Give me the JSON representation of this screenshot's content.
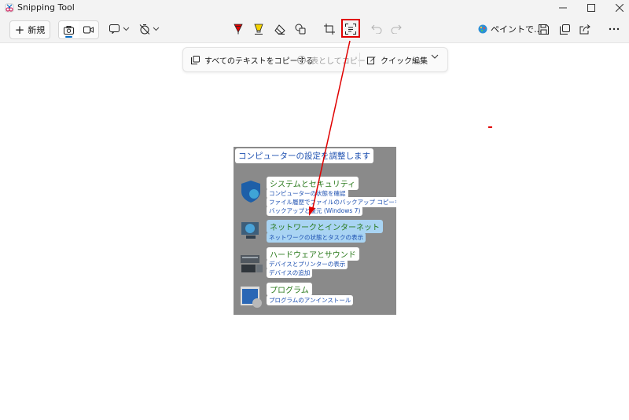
{
  "window": {
    "title": "Snipping Tool",
    "controls": [
      "minimize",
      "maximize",
      "close"
    ]
  },
  "toolbar": {
    "new_label": "新規",
    "modes": [
      {
        "icon": "camera-icon",
        "active": true
      },
      {
        "icon": "video-icon",
        "active": false
      }
    ],
    "paint_label": "ペイントで..."
  },
  "text_actions": {
    "copy_all_label": "すべてのテキストをコピーする",
    "copy_table_label": "表としてコピー",
    "quick_edit_label": "クイック編集"
  },
  "captured_image": {
    "heading": "コンピューターの設定を調整します",
    "categories": [
      {
        "title": "システムとセキュリティ",
        "links": [
          "コンピューターの状態を確認",
          "ファイル履歴でファイルのバックアップ コピーを保存",
          "バックアップと復元 (Windows 7)"
        ]
      },
      {
        "title": "ネットワークとインターネット",
        "links": [
          "ネットワークの状態とタスクの表示"
        ],
        "selected": true
      },
      {
        "title": "ハードウェアとサウンド",
        "links": [
          "デバイスとプリンターの表示",
          "デバイスの追加"
        ]
      },
      {
        "title": "プログラム",
        "links": [
          "プログラムのアンインストール"
        ]
      }
    ]
  },
  "colors": {
    "annotation_red": "#e00000",
    "accent": "#0067c0",
    "captured_bg": "#8a8a8a",
    "link_blue": "#1c4fb0",
    "category_green": "#2a7a1c"
  }
}
